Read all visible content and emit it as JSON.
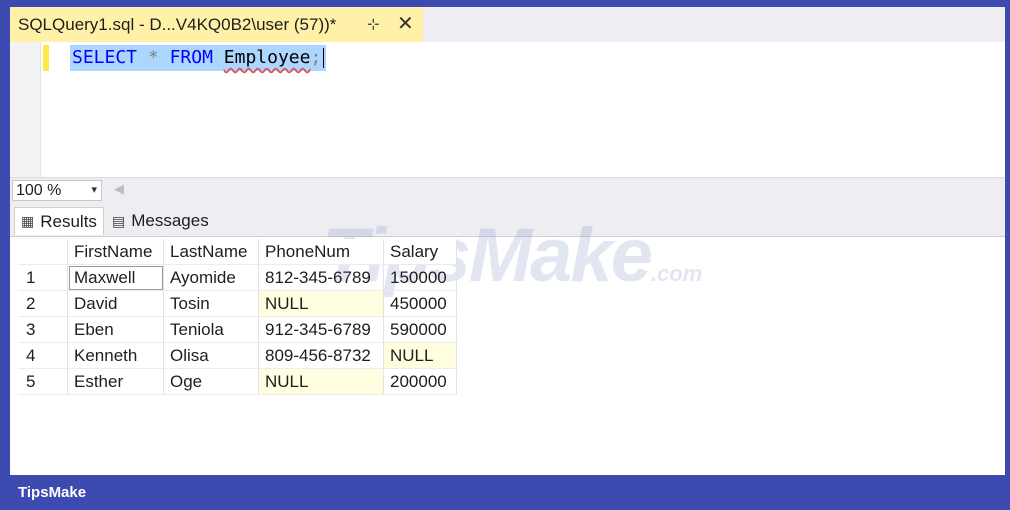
{
  "tab": {
    "title": "SQLQuery1.sql - D...V4KQ0B2\\user (57))*",
    "pin_glyph": "⊹",
    "close_glyph": "✕"
  },
  "editor": {
    "keyword_select": "SELECT",
    "star": "*",
    "keyword_from": "FROM",
    "table_name": "Employee",
    "semicolon": ";"
  },
  "zoom": {
    "value": "100 %",
    "arrow": "▾",
    "scroll_left": "◀"
  },
  "results_tabs": [
    {
      "label": "Results",
      "icon": "grid-icon",
      "glyph": "▦",
      "active": true
    },
    {
      "label": "Messages",
      "icon": "messages-icon",
      "glyph": "▤",
      "active": false
    }
  ],
  "grid": {
    "columns": [
      "FirstName",
      "LastName",
      "PhoneNum",
      "Salary"
    ],
    "rows": [
      {
        "num": "1",
        "cells": [
          "Maxwell",
          "Ayomide",
          "812-345-6789",
          "150000"
        ]
      },
      {
        "num": "2",
        "cells": [
          "David",
          "Tosin",
          "NULL",
          "450000"
        ]
      },
      {
        "num": "3",
        "cells": [
          "Eben",
          "Teniola",
          "912-345-6789",
          "590000"
        ]
      },
      {
        "num": "4",
        "cells": [
          "Kenneth",
          "Olisa",
          "809-456-8732",
          "NULL"
        ]
      },
      {
        "num": "5",
        "cells": [
          "Esther",
          "Oge",
          "NULL",
          "200000"
        ]
      }
    ]
  },
  "watermark": {
    "text": "TipsMake",
    "suffix": ".com"
  },
  "brand": "TipsMake",
  "colors": {
    "frame": "#3d4bb0",
    "tab_active": "#fff1a8",
    "selection": "#add6ff",
    "null_cell": "#fffee0"
  }
}
